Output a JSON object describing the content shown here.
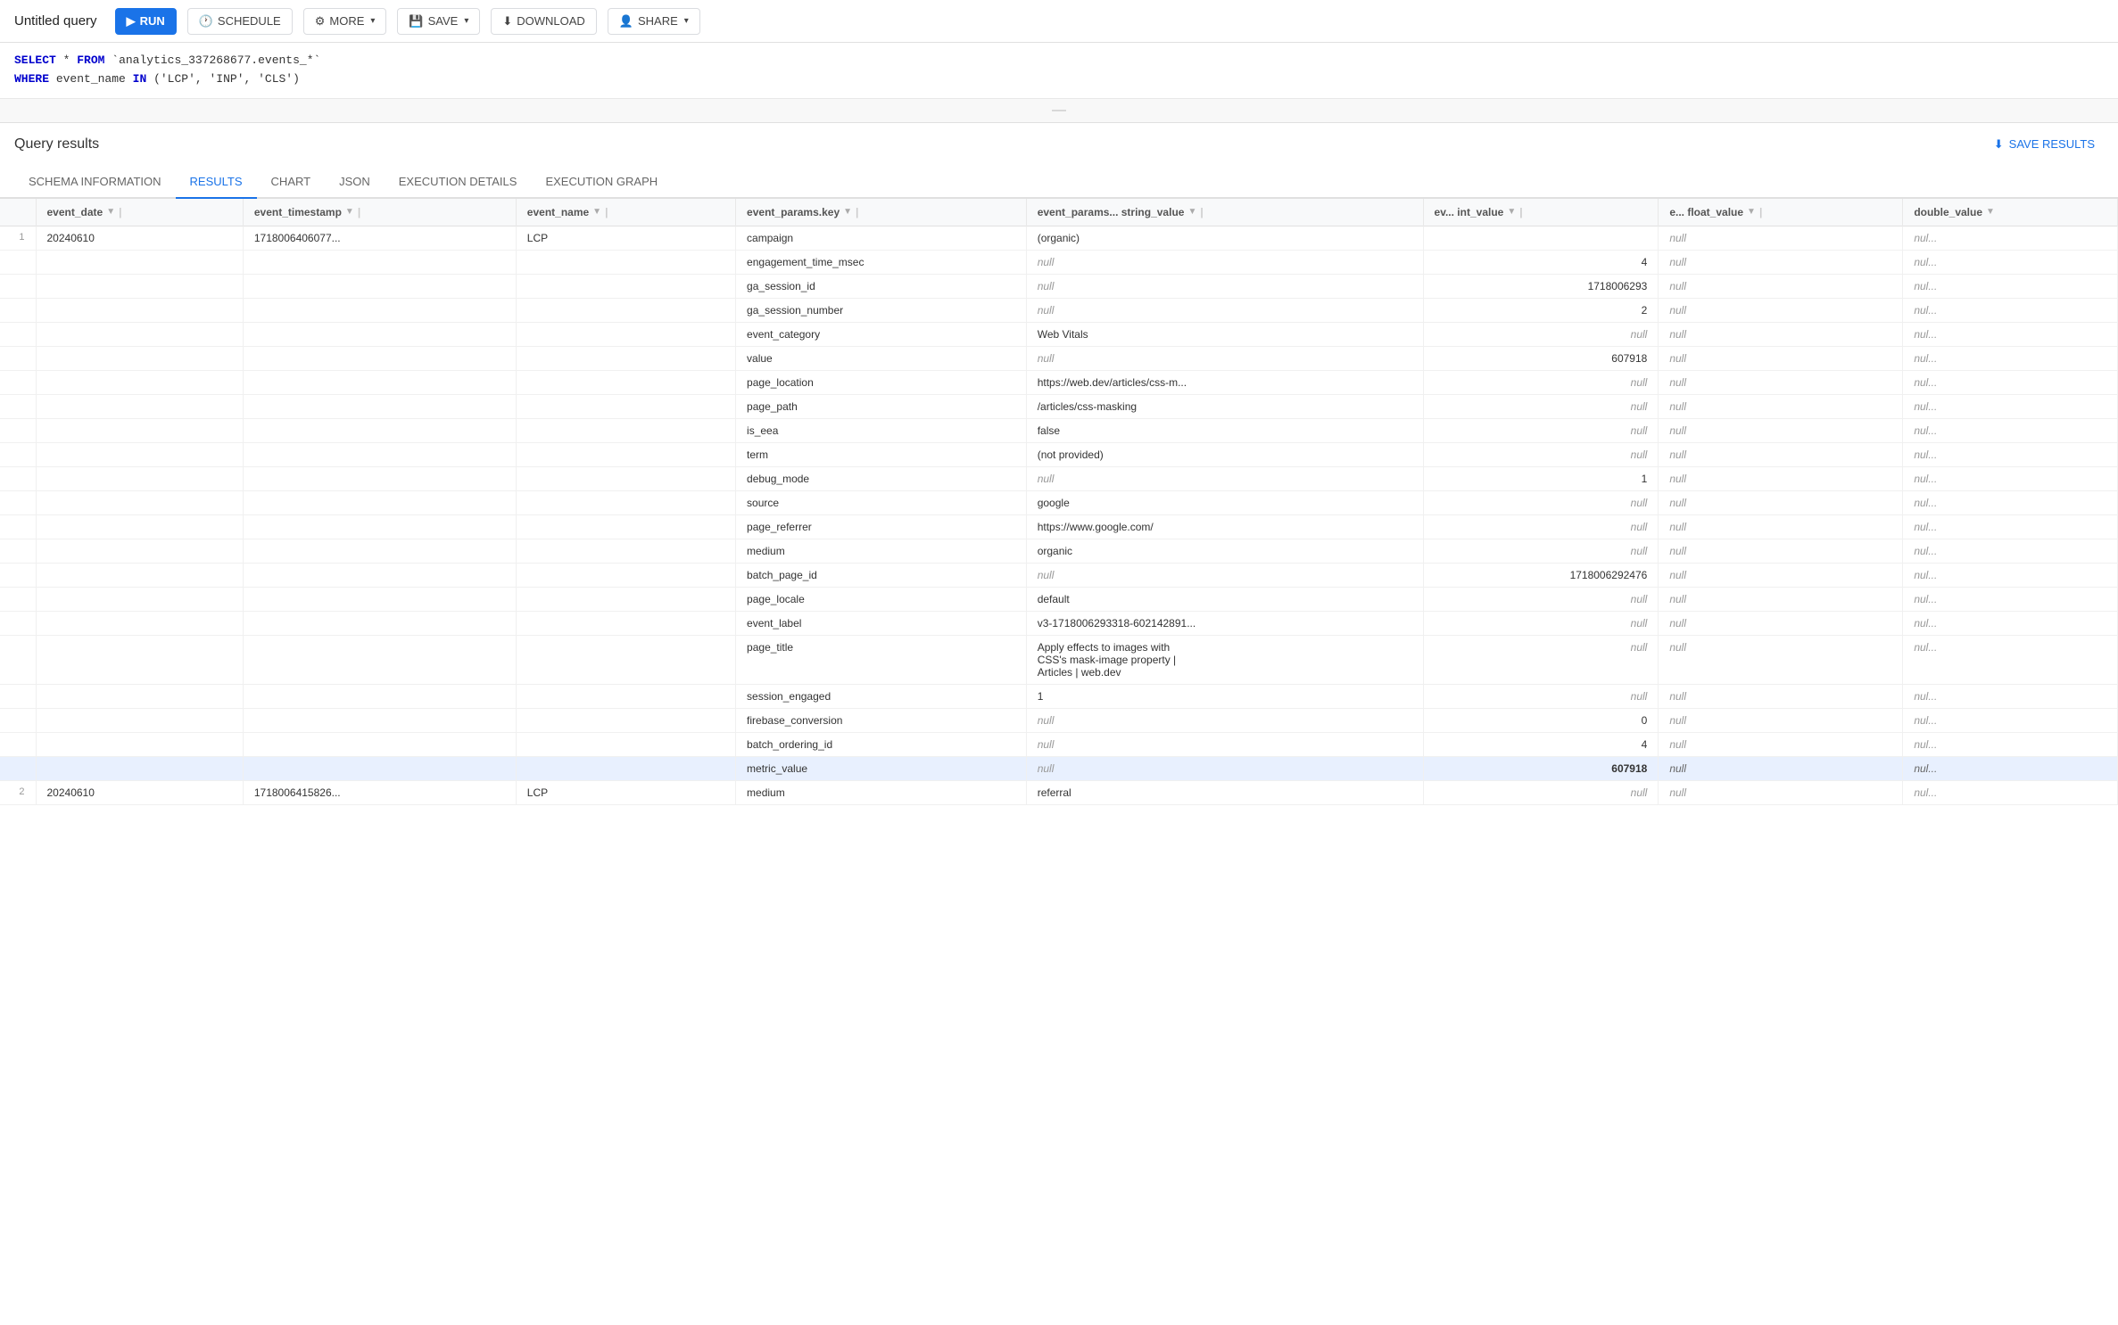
{
  "app": {
    "title": "Untitled query"
  },
  "toolbar": {
    "run_label": "RUN",
    "schedule_label": "SCHEDULE",
    "more_label": "MORE",
    "save_label": "SAVE",
    "download_label": "DOWNLOAD",
    "share_label": "SHARE"
  },
  "sql": {
    "line1_kw1": "SELECT",
    "line1_star": "*",
    "line1_kw2": "FROM",
    "line1_table": "`analytics_337268677.events_*`",
    "line2_kw1": "WHERE",
    "line2_col": "event_name",
    "line2_kw2": "IN",
    "line2_vals": "('LCP', 'INP', 'CLS')"
  },
  "results": {
    "title": "Query results",
    "save_label": "SAVE RESULTS"
  },
  "tabs": [
    {
      "id": "schema",
      "label": "SCHEMA INFORMATION"
    },
    {
      "id": "results",
      "label": "RESULTS",
      "active": true
    },
    {
      "id": "chart",
      "label": "CHART"
    },
    {
      "id": "json",
      "label": "JSON"
    },
    {
      "id": "execution_details",
      "label": "EXECUTION DETAILS"
    },
    {
      "id": "execution_graph",
      "label": "EXECUTION GRAPH"
    }
  ],
  "columns": [
    {
      "id": "row_num",
      "label": ""
    },
    {
      "id": "event_date",
      "label": "event_date",
      "sort": true
    },
    {
      "id": "event_timestamp",
      "label": "event_timestamp",
      "sort": true
    },
    {
      "id": "event_name",
      "label": "event_name",
      "sort": true
    },
    {
      "id": "params_key",
      "label": "event_params.key",
      "sort": true
    },
    {
      "id": "params_string",
      "label": "event_params... string_value",
      "sort": true
    },
    {
      "id": "params_int",
      "label": "ev... int_value",
      "sort": true
    },
    {
      "id": "params_float",
      "label": "e... float_value",
      "sort": true
    },
    {
      "id": "params_double",
      "label": "double_value",
      "sort": true
    }
  ],
  "rows": [
    {
      "row_num": "1",
      "event_date": "20240610",
      "event_timestamp": "1718006406077...",
      "event_name": "LCP",
      "params": [
        {
          "key": "campaign",
          "string_value": "(organic)",
          "int_value": "",
          "float_value": "",
          "double_value": ""
        },
        {
          "key": "engagement_time_msec",
          "string_value": "null",
          "int_value": "4",
          "float_value": "",
          "double_value": ""
        },
        {
          "key": "ga_session_id",
          "string_value": "null",
          "int_value": "1718006293",
          "float_value": "",
          "double_value": ""
        },
        {
          "key": "ga_session_number",
          "string_value": "null",
          "int_value": "2",
          "float_value": "",
          "double_value": ""
        },
        {
          "key": "event_category",
          "string_value": "Web Vitals",
          "int_value": "null",
          "float_value": "",
          "double_value": ""
        },
        {
          "key": "value",
          "string_value": "null",
          "int_value": "607918",
          "float_value": "",
          "double_value": ""
        },
        {
          "key": "page_location",
          "string_value": "https://web.dev/articles/css-m...",
          "int_value": "null",
          "float_value": "",
          "double_value": ""
        },
        {
          "key": "page_path",
          "string_value": "/articles/css-masking",
          "int_value": "null",
          "float_value": "",
          "double_value": ""
        },
        {
          "key": "is_eea",
          "string_value": "false",
          "int_value": "null",
          "float_value": "",
          "double_value": ""
        },
        {
          "key": "term",
          "string_value": "(not provided)",
          "int_value": "null",
          "float_value": "",
          "double_value": ""
        },
        {
          "key": "debug_mode",
          "string_value": "null",
          "int_value": "1",
          "float_value": "",
          "double_value": ""
        },
        {
          "key": "source",
          "string_value": "google",
          "int_value": "null",
          "float_value": "",
          "double_value": ""
        },
        {
          "key": "page_referrer",
          "string_value": "https://www.google.com/",
          "int_value": "null",
          "float_value": "",
          "double_value": ""
        },
        {
          "key": "medium",
          "string_value": "organic",
          "int_value": "null",
          "float_value": "",
          "double_value": ""
        },
        {
          "key": "batch_page_id",
          "string_value": "null",
          "int_value": "1718006292476",
          "float_value": "",
          "double_value": ""
        },
        {
          "key": "page_locale",
          "string_value": "default",
          "int_value": "null",
          "float_value": "",
          "double_value": ""
        },
        {
          "key": "event_label",
          "string_value": "v3-1718006293318-602142891...",
          "int_value": "null",
          "float_value": "",
          "double_value": ""
        },
        {
          "key": "page_title",
          "string_value": "Apply effects to images with\nCSS's mask-image property  |\nArticles | web.dev",
          "int_value": "null",
          "float_value": "",
          "double_value": "",
          "multiline": true
        },
        {
          "key": "session_engaged",
          "string_value": "1",
          "int_value": "null",
          "float_value": "",
          "double_value": ""
        },
        {
          "key": "firebase_conversion",
          "string_value": "null",
          "int_value": "0",
          "float_value": "",
          "double_value": ""
        },
        {
          "key": "batch_ordering_id",
          "string_value": "null",
          "int_value": "4",
          "float_value": "",
          "double_value": ""
        },
        {
          "key": "metric_value",
          "string_value": "null",
          "int_value": "607918",
          "float_value": "null",
          "double_value": "nul...",
          "highlight": true
        }
      ]
    },
    {
      "row_num": "2",
      "event_date": "20240610",
      "event_timestamp": "1718006415826...",
      "event_name": "LCP",
      "params": [
        {
          "key": "medium",
          "string_value": "referral",
          "int_value": "null",
          "float_value": "",
          "double_value": ""
        }
      ]
    }
  ]
}
